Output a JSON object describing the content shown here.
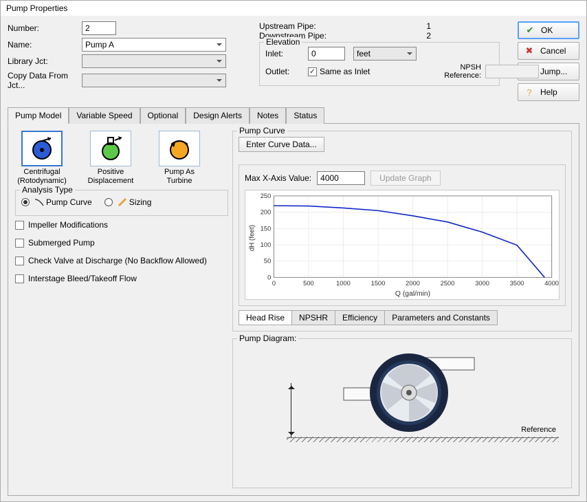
{
  "window": {
    "title": "Pump Properties"
  },
  "form": {
    "number_label": "Number:",
    "number_value": "2",
    "name_label": "Name:",
    "name_value": "Pump A",
    "library_label": "Library Jct:",
    "library_value": "",
    "copy_from_label": "Copy Data From Jct...",
    "copy_from_value": ""
  },
  "pipes": {
    "upstream_label": "Upstream Pipe:",
    "upstream_value": "1",
    "downstream_label": "Downstream Pipe:",
    "downstream_value": "2"
  },
  "elevation": {
    "group_label": "Elevation",
    "inlet_label": "Inlet:",
    "inlet_value": "0",
    "inlet_unit": "feet",
    "outlet_label": "Outlet:",
    "same_as_inlet": "Same as Inlet",
    "npsh_ref_label": "NPSH Reference:"
  },
  "buttons": {
    "ok": "OK",
    "cancel": "Cancel",
    "jump": "Jump...",
    "help": "Help"
  },
  "tabs": [
    "Pump Model",
    "Variable Speed",
    "Optional",
    "Design Alerts",
    "Notes",
    "Status"
  ],
  "models": {
    "centrifugal": "Centrifugal (Rotodynamic)",
    "positive": "Positive Displacement",
    "turbine": "Pump As Turbine"
  },
  "analysis": {
    "group_label": "Analysis Type",
    "pump_curve": "Pump Curve",
    "sizing": "Sizing"
  },
  "checks": {
    "impeller": "Impeller Modifications",
    "submerged": "Submerged Pump",
    "check_valve": "Check Valve at Discharge (No Backflow Allowed)",
    "interstage": "Interstage Bleed/Takeoff Flow"
  },
  "curve": {
    "group_label": "Pump Curve",
    "enter_data_btn": "Enter Curve Data...",
    "max_x_label": "Max X-Axis Value:",
    "max_x_value": "4000",
    "update_btn": "Update Graph",
    "subtabs": [
      "Head Rise",
      "NPSHR",
      "Efficiency",
      "Parameters and Constants"
    ]
  },
  "diagram": {
    "label": "Pump Diagram:",
    "reference": "Reference"
  },
  "chart_data": {
    "type": "line",
    "title": "",
    "xlabel": "Q (gal/min)",
    "ylabel": "dH (feet)",
    "xlim": [
      0,
      4000
    ],
    "ylim": [
      0,
      250
    ],
    "x_ticks": [
      0,
      500,
      1000,
      1500,
      2000,
      2500,
      3000,
      3500,
      4000
    ],
    "y_ticks": [
      0,
      50,
      100,
      150,
      200,
      250
    ],
    "series": [
      {
        "name": "Head Rise",
        "x": [
          0,
          500,
          1000,
          1500,
          2000,
          2500,
          3000,
          3500,
          3900
        ],
        "y": [
          220,
          219,
          213,
          205,
          189,
          170,
          139,
          99,
          0
        ]
      }
    ]
  }
}
